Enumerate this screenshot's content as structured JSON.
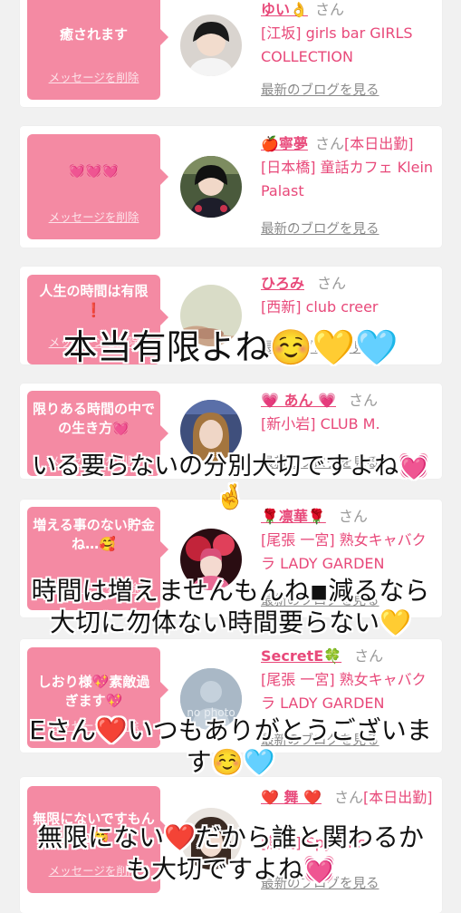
{
  "cards": [
    {
      "message": "癒されます",
      "delete_label": "メッセージを削除",
      "name": "ゆい👌",
      "san": "さん",
      "extra": "",
      "shop": "[江坂] girls bar GIRLS COLLECTION",
      "blog_label": "最新のブログを見る"
    },
    {
      "message": "💓💓💓",
      "delete_label": "メッセージを削除",
      "name": "🍎寧夢",
      "san": "さん",
      "extra": "[本日出勤]",
      "shop": "[日本橋] 童話カフェ Klein Palast",
      "blog_label": "最新のブログを見る"
    },
    {
      "message": "人生の時間は有限❗",
      "delete_label": "メッセージを削除",
      "name": "ひろみ",
      "san": "さん",
      "extra": "",
      "shop": "[西新] club creer",
      "blog_label": "最新のブログを見る"
    },
    {
      "message": "限りある時間の中での生き方💓",
      "delete_label": "メッセージを削除",
      "name": "💗 あん 💗",
      "san": "さん",
      "extra": "",
      "shop": "[新小岩] CLUB M.",
      "blog_label": "最新のブログを見る"
    },
    {
      "message": "増える事のない貯金ね…🥰",
      "delete_label": "メッセージを削除",
      "name": "🌹凛華🌹",
      "san": "さん",
      "extra": "",
      "shop": "[尾張 一宮] 熟女キャバクラ LADY GARDEN",
      "blog_label": "最新のブログを見る"
    },
    {
      "message": "しおり様💖素敵過ぎます💖",
      "delete_label": "メッセージを削除",
      "name": "SecretE🍀",
      "san": "さん",
      "extra": "",
      "shop": "[尾張 一宮] 熟女キャバクラ LADY GARDEN",
      "blog_label": "最新のブログを見る",
      "avatar_text": "no photo"
    },
    {
      "message": "無限にないですもんね🥰",
      "delete_label": "メッセージを削除",
      "name": "❤️ 舞 ❤️",
      "san": "さん",
      "extra": "[本日出勤]",
      "shop": "[船橋] SpyGirls",
      "blog_label": "最新のブログを見る"
    }
  ],
  "captions": [
    "本当有限よね☺️💛🩵",
    "いる要らないの分別大切ですよね💓\n🤞",
    "時間は増えませんもんね◾︎減るなら\n大切に勿体ない時間要らない💛",
    "Eさん❤️いつもありがとうございま\nす☺️🩵",
    "無限にない❤️だから誰と関わるか\nも大切ですよね💓"
  ]
}
